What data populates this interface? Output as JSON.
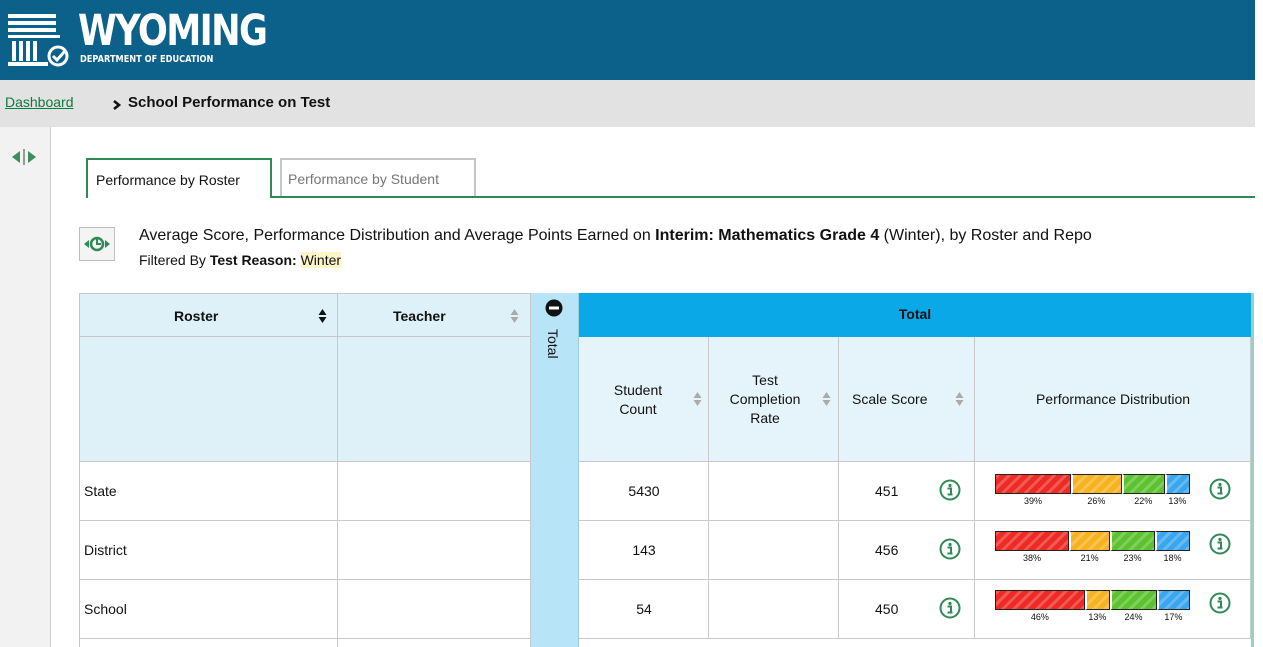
{
  "header": {
    "title": "WYOMING",
    "subtitle": "DEPARTMENT OF EDUCATION"
  },
  "breadcrumb": {
    "link": "Dashboard",
    "separator": "›",
    "current": "School Performance on Test"
  },
  "tabs": [
    {
      "label": "Performance by Roster",
      "active": true
    },
    {
      "label": "Performance by Student",
      "active": false
    }
  ],
  "description": {
    "prefix": "Average Score, Performance Distribution and Average Points Earned on ",
    "test_name": "Interim: Mathematics Grade 4",
    "suffix": " (Winter), by Roster and Repo",
    "filter_prefix": "Filtered By ",
    "filter_label": "Test Reason:",
    "filter_value": "Winter"
  },
  "table": {
    "col_roster": "Roster",
    "col_teacher": "Teacher",
    "collapse_label": "Total",
    "group_label": "Total",
    "col_student_count": "Student Count",
    "col_completion": "Test Completion Rate",
    "col_scale_score": "Scale Score",
    "col_perf_dist": "Performance Distribution",
    "rows": [
      {
        "roster": "State",
        "teacher": "",
        "student_count": "5430",
        "completion": "",
        "scale_score": "451",
        "dist": [
          39,
          26,
          22,
          13
        ],
        "labels": [
          "39%",
          "26%",
          "22%",
          "13%"
        ]
      },
      {
        "roster": "District",
        "teacher": "",
        "student_count": "143",
        "completion": "",
        "scale_score": "456",
        "dist": [
          38,
          21,
          23,
          18
        ],
        "labels": [
          "38%",
          "21%",
          "23%",
          "18%"
        ]
      },
      {
        "roster": "School",
        "teacher": "",
        "student_count": "54",
        "completion": "",
        "scale_score": "450",
        "dist": [
          46,
          13,
          24,
          17
        ],
        "labels": [
          "46%",
          "13%",
          "24%",
          "17%"
        ]
      }
    ]
  },
  "colors": {
    "header_bg": "#0b6189",
    "band": "#0aa8e6",
    "level1": "#ee2a24",
    "level2": "#f7b220",
    "level3": "#5cc22f",
    "level4": "#3aa6ef",
    "link": "#0d7a41"
  }
}
